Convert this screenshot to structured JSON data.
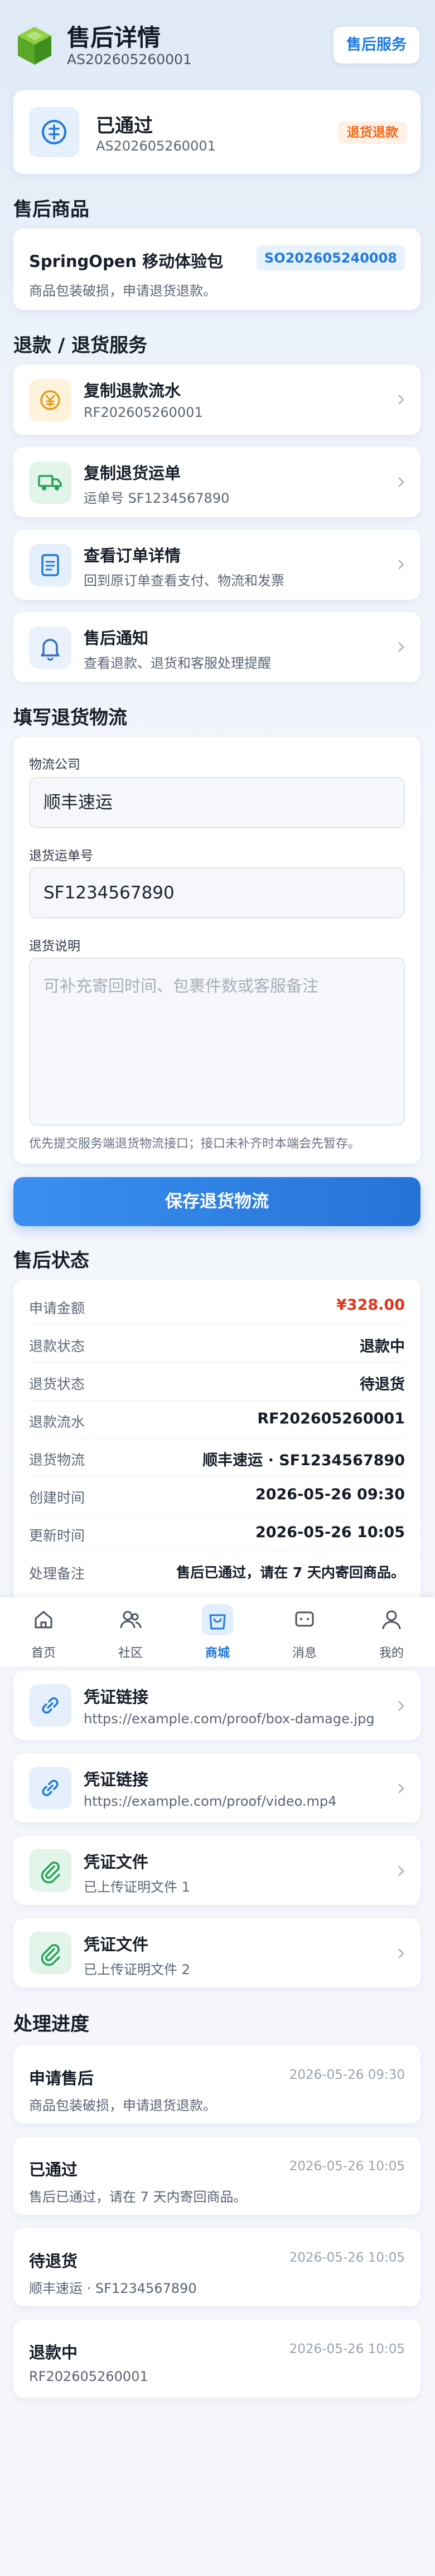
{
  "header": {
    "title": "售后详情",
    "subtitle": "AS202605260001",
    "action_label": "售后服务"
  },
  "status_card": {
    "status": "已通过",
    "number": "AS202605260001",
    "badge": "退货退款"
  },
  "product_section": {
    "title": "售后商品",
    "name": "SpringOpen 移动体验包",
    "order_tag": "SO202605240008",
    "reason": "商品包装破损，申请退货退款。"
  },
  "services": {
    "title": "退款 / 退货服务",
    "items": [
      {
        "title": "复制退款流水",
        "sub": "RF202605260001",
        "icon": "yen-coin-icon"
      },
      {
        "title": "复制退货运单",
        "sub": "运单号 SF1234567890",
        "icon": "truck-icon"
      },
      {
        "title": "查看订单详情",
        "sub": "回到原订单查看支付、物流和发票",
        "icon": "document-icon"
      },
      {
        "title": "售后通知",
        "sub": "查看退款、退货和客服处理提醒",
        "icon": "bell-icon"
      }
    ]
  },
  "logistics_form": {
    "title": "填写退货物流",
    "company_label": "物流公司",
    "company_value": "顺丰速运",
    "tracking_label": "退货运单号",
    "tracking_value": "SF1234567890",
    "note_label": "退货说明",
    "note_placeholder": "可补充寄回时间、包裹件数或客服备注",
    "hint": "优先提交服务端退货物流接口；接口未补齐时本端会先暂存。",
    "save_label": "保存退货物流"
  },
  "status_section": {
    "title": "售后状态",
    "rows": [
      {
        "label": "申请金额",
        "value": "¥328.00",
        "accent": true
      },
      {
        "label": "退款状态",
        "value": "退款中"
      },
      {
        "label": "退货状态",
        "value": "待退货"
      },
      {
        "label": "退款流水",
        "value": "RF202605260001"
      },
      {
        "label": "退货物流",
        "value": "顺丰速运 · SF1234567890"
      },
      {
        "label": "创建时间",
        "value": "2026-05-26 09:30"
      },
      {
        "label": "更新时间",
        "value": "2026-05-26 10:05"
      },
      {
        "label": "处理备注",
        "value": "售后已通过，请在 7 天内寄回商品。"
      }
    ]
  },
  "bottom_nav": {
    "items": [
      {
        "label": "首页",
        "icon": "home-icon",
        "active": false
      },
      {
        "label": "社区",
        "icon": "people-icon",
        "active": false
      },
      {
        "label": "商城",
        "icon": "shopping-bag-icon",
        "active": true
      },
      {
        "label": "消息",
        "icon": "message-icon",
        "active": false
      },
      {
        "label": "我的",
        "icon": "user-icon",
        "active": false
      }
    ]
  },
  "evidence": {
    "items": [
      {
        "title": "凭证链接",
        "sub": "https://example.com/proof/box-damage.jpg",
        "icon": "link-icon"
      },
      {
        "title": "凭证链接",
        "sub": "https://example.com/proof/video.mp4",
        "icon": "link-icon"
      },
      {
        "title": "凭证文件",
        "sub": "已上传证明文件 1",
        "icon": "paperclip-icon"
      },
      {
        "title": "凭证文件",
        "sub": "已上传证明文件 2",
        "icon": "paperclip-icon"
      }
    ]
  },
  "progress": {
    "title": "处理进度",
    "items": [
      {
        "title": "申请售后",
        "time": "2026-05-26 09:30",
        "desc": "商品包装破损，申请退货退款。"
      },
      {
        "title": "已通过",
        "time": "2026-05-26 10:05",
        "desc": "售后已通过，请在 7 天内寄回商品。"
      },
      {
        "title": "待退货",
        "time": "2026-05-26 10:05",
        "desc": "顺丰速运 · SF1234567890"
      },
      {
        "title": "退款中",
        "time": "2026-05-26 10:05",
        "desc": "RF202605260001"
      }
    ]
  },
  "colors": {
    "primary": "#1f7ae0",
    "accent_red": "#e2331a",
    "badge_orange": "#f06a1d",
    "success_green": "#27a45a"
  }
}
